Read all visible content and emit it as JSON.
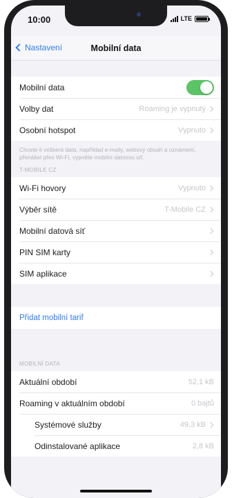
{
  "status_bar": {
    "time": "10:00",
    "network": "LTE"
  },
  "navbar": {
    "back_label": "Nastavení",
    "title": "Mobilní data"
  },
  "main_group": {
    "mobile_data": {
      "label": "Mobilní data",
      "enabled": true
    },
    "data_options": {
      "label": "Volby dat",
      "value": "Roaming je vypnutý"
    },
    "hotspot": {
      "label": "Osobní hotspot",
      "value": "Vypnuto"
    }
  },
  "footnote": "Chcete-li veškerá data, například e-maily, webový obsah a oznámení, přenášet přes Wi-Fi, vypněte mobilní datovou síť.",
  "carrier_section": {
    "header": "T-MOBILE CZ",
    "rows": [
      {
        "label": "Wi-Fi hovory",
        "value": "Vypnuto"
      },
      {
        "label": "Výběr sítě",
        "value": "T-Mobile CZ"
      },
      {
        "label": "Mobilní datová síť",
        "value": ""
      },
      {
        "label": "PIN SIM karty",
        "value": ""
      },
      {
        "label": "SIM aplikace",
        "value": ""
      }
    ]
  },
  "add_plan": {
    "label": "Přidat mobilní tarif"
  },
  "usage_section": {
    "header": "MOBILNÍ DATA",
    "rows": [
      {
        "label": "Aktuální období",
        "value": "52,1 kB"
      },
      {
        "label": "Roaming v aktuálním období",
        "value": "0 bajtů"
      },
      {
        "label": "Systémové služby",
        "value": "49,3 kB"
      },
      {
        "label": "Odinstalované aplikace",
        "value": "2,8 kB"
      }
    ]
  },
  "colors": {
    "accent": "#2f7cf6",
    "toggle_on": "#5bc465",
    "background": "#f2f2f7"
  }
}
